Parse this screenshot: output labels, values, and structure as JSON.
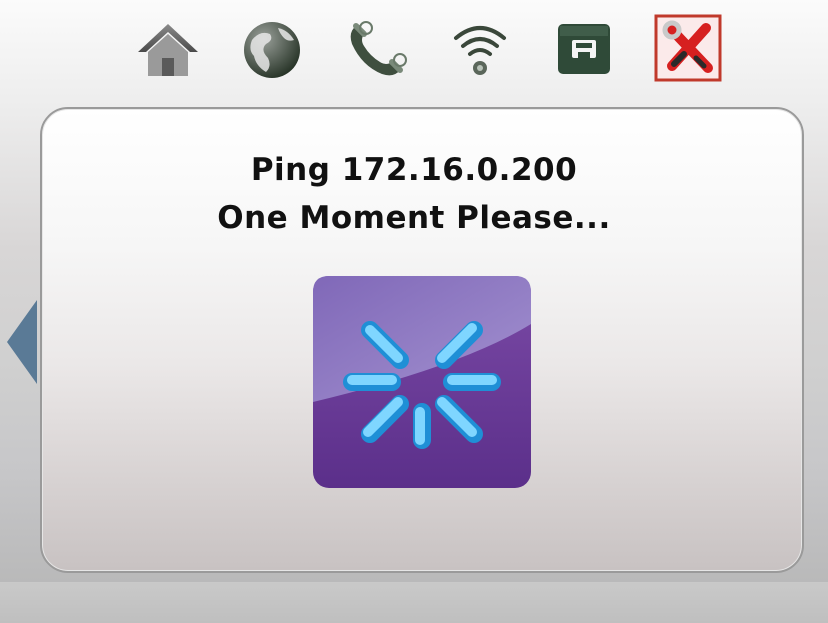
{
  "toolbar": {
    "buttons": [
      {
        "name": "home",
        "icon": "home-icon"
      },
      {
        "name": "internet",
        "icon": "globe-icon"
      },
      {
        "name": "phone",
        "icon": "phone-icon"
      },
      {
        "name": "wifi",
        "icon": "wifi-icon"
      },
      {
        "name": "ethernet",
        "icon": "ethernet-icon"
      },
      {
        "name": "tools",
        "icon": "tools-icon",
        "active": true
      }
    ]
  },
  "dialog": {
    "line1": "Ping 172.16.0.200",
    "line2": "One Moment Please...",
    "spinner_icon": "loading-spinner-icon"
  },
  "navigation": {
    "back_icon": "left-arrow-icon"
  },
  "colors": {
    "spinner_bg": "#6a3f97",
    "spinner_ray": "#29b6f6",
    "active_tab_border": "#c0392b",
    "arrow": "#5a7a96"
  }
}
